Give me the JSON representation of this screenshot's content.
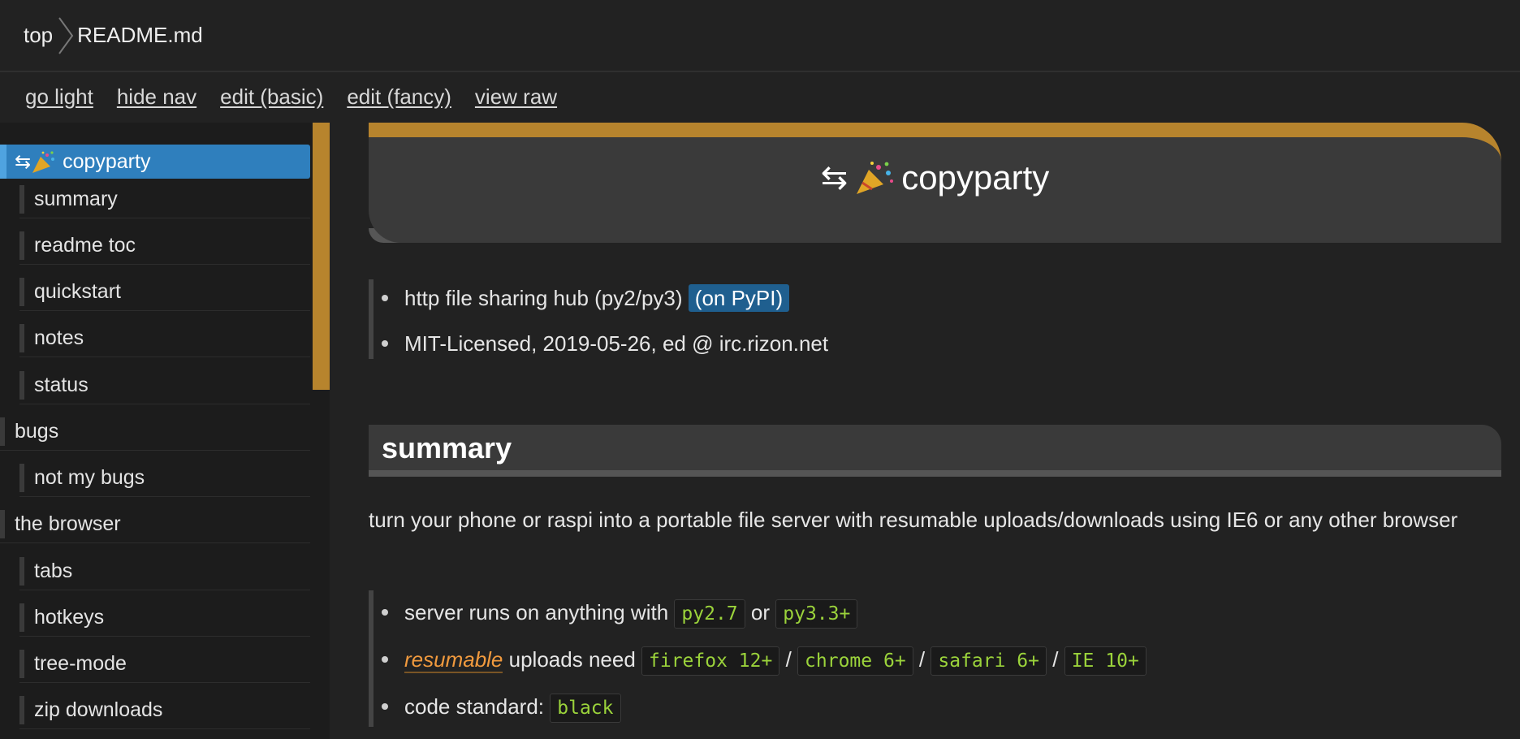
{
  "breadcrumb": {
    "root": "top",
    "current": "README.md"
  },
  "toolbar": {
    "links": [
      "go light",
      "hide nav",
      "edit (basic)",
      "edit (fancy)",
      "view raw"
    ]
  },
  "sidebar": {
    "items": [
      {
        "label": "copyparty",
        "level": 1,
        "active": true
      },
      {
        "label": "summary",
        "level": 2
      },
      {
        "label": "readme toc",
        "level": 2
      },
      {
        "label": "quickstart",
        "level": 2
      },
      {
        "label": "notes",
        "level": 2
      },
      {
        "label": "status",
        "level": 2
      },
      {
        "label": "bugs",
        "level": 1
      },
      {
        "label": "not my bugs",
        "level": 2
      },
      {
        "label": "the browser",
        "level": 1
      },
      {
        "label": "tabs",
        "level": 2
      },
      {
        "label": "hotkeys",
        "level": 2
      },
      {
        "label": "tree-mode",
        "level": 2
      },
      {
        "label": "zip downloads",
        "level": 2
      }
    ]
  },
  "main": {
    "title": "copyparty",
    "intro": {
      "item1_text": "http file sharing hub (py2/py3)",
      "item1_pill": "(on PyPI)",
      "item2_text": "MIT-Licensed, 2019-05-26, ed @ irc.rizon.net"
    },
    "summary_heading": "summary",
    "summary_para": "turn your phone or raspi into a portable file server with resumable uploads/downloads using IE6 or any other browser",
    "features": {
      "f1_text": "server runs on anything with",
      "f1_code1": "py2.7",
      "f1_or": "or",
      "f1_code2": "py3.3+",
      "f2_link": "resumable",
      "f2_text": "uploads need",
      "f2_codes": [
        "firefox 12+",
        "chrome 6+",
        "safari 6+",
        "IE 10+"
      ],
      "f2_sep": "/",
      "f3_text": "code standard:",
      "f3_code": "black"
    }
  },
  "colors": {
    "background": "#222222",
    "accent_gold": "#b7842d",
    "active_blue": "#2f7fbd",
    "code_green": "#9bd33b",
    "link_orange": "#f19a3e"
  }
}
